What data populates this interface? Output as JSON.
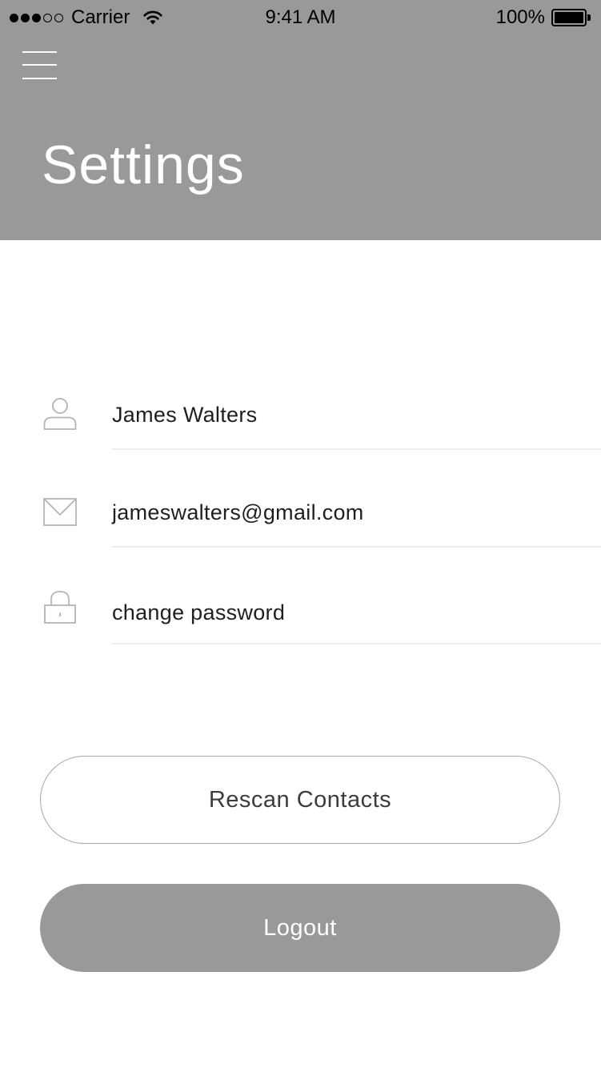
{
  "status_bar": {
    "carrier": "Carrier",
    "time": "9:41 AM",
    "battery": "100%",
    "signal_icon": "signal-dots-icon",
    "wifi_icon": "wifi-icon",
    "battery_icon": "battery-icon"
  },
  "header": {
    "menu_icon": "hamburger-menu-icon",
    "title": "Settings",
    "background_color": "#999999"
  },
  "settings": {
    "rows": [
      {
        "icon": "person-icon",
        "value": "James Walters"
      },
      {
        "icon": "envelope-icon",
        "value": "jameswalters@gmail.com"
      },
      {
        "icon": "lock-icon",
        "value": "change password"
      }
    ]
  },
  "actions": {
    "rescan_label": "Rescan Contacts",
    "logout_label": "Logout"
  },
  "colors": {
    "accent_gray": "#999999",
    "text": "#1f1f1f",
    "icon_stroke": "#b5b5b5"
  }
}
